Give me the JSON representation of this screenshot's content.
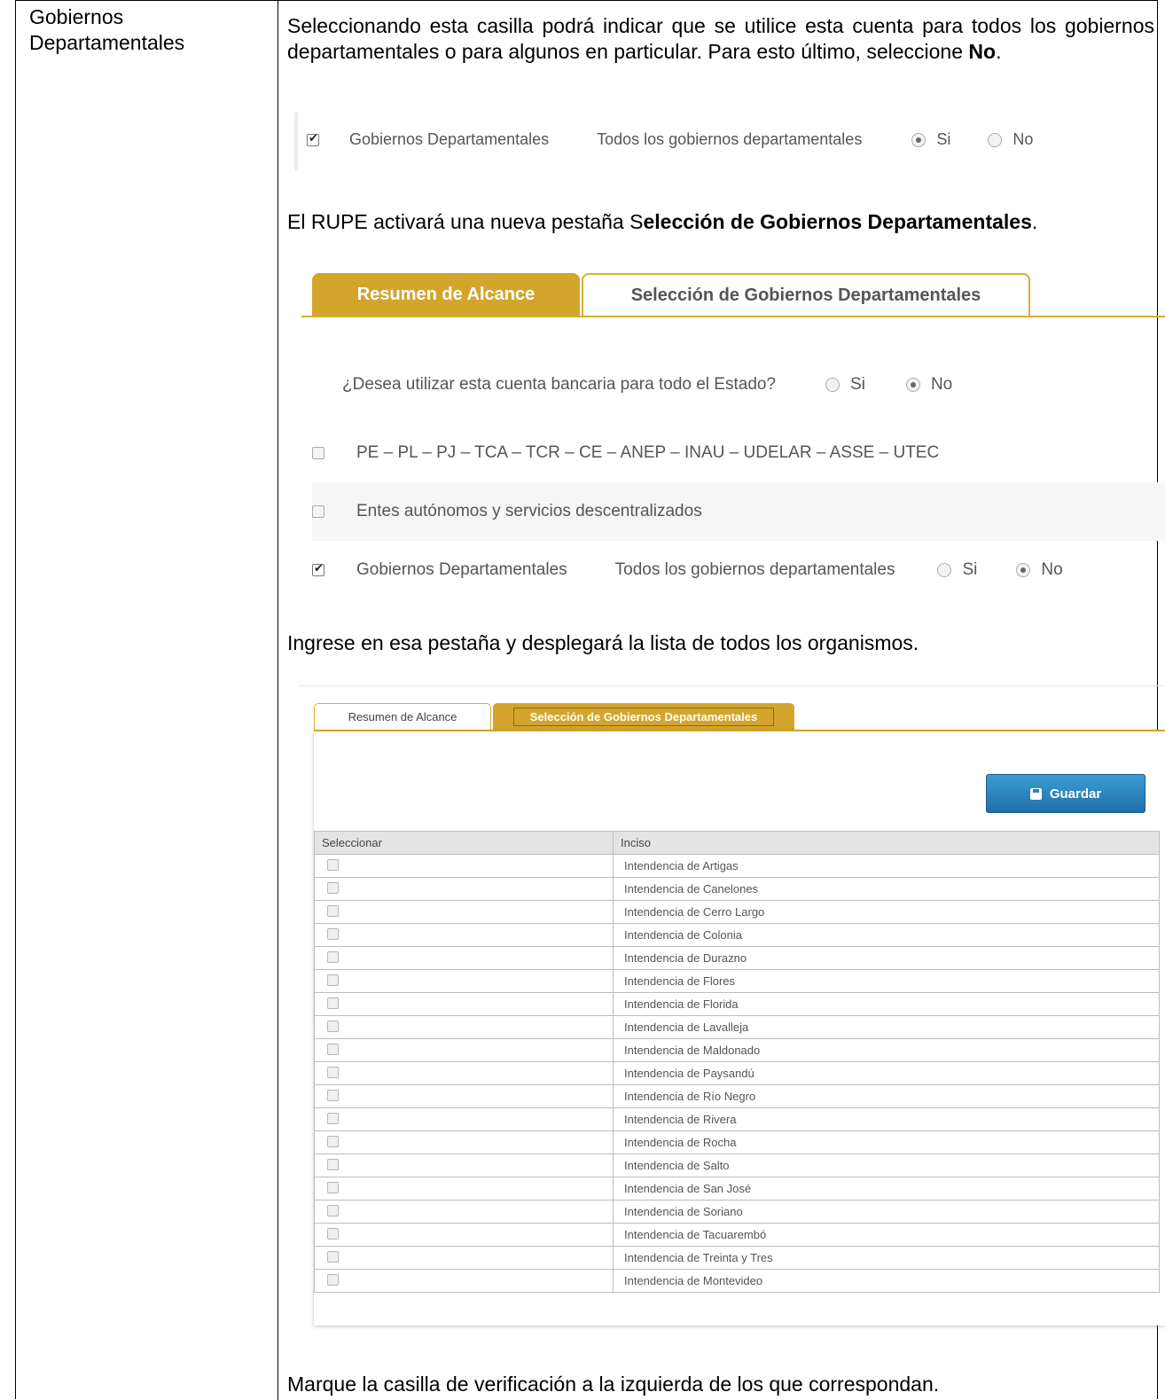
{
  "left_label": "Gobiernos Departamentales",
  "para1": {
    "text": "Seleccionando esta casilla podrá indicar que se utilice esta cuenta para todos los gobiernos departamentales o para algunos en particular. Para esto último, seleccione ",
    "bold": "No",
    "end": "."
  },
  "shot1": {
    "checkbox_label": "Gobiernos Departamentales",
    "question": "Todos los gobiernos departamentales",
    "opt_si": "Si",
    "opt_no": "No",
    "selected": "Si"
  },
  "para2": {
    "text": "El RUPE activará una nueva pestaña S",
    "bold": "elección de Gobiernos Departamentales",
    "end": "."
  },
  "shot2": {
    "tab_active": "Resumen de Alcance",
    "tab_inactive": "Selección de Gobiernos Departamentales",
    "question": "¿Desea utilizar esta cuenta bancaria para todo el Estado?",
    "opt_si": "Si",
    "opt_no": "No",
    "selected": "No",
    "line1": "PE – PL – PJ – TCA – TCR – CE – ANEP – INAU – UDELAR – ASSE – UTEC",
    "line2": "Entes autónomos y servicios descentralizados",
    "line3_label": "Gobiernos Departamentales",
    "line3_question": "Todos los gobiernos departamentales",
    "line3_selected": "No"
  },
  "para3": "Ingrese en esa pestaña y desplegará la lista de todos los organismos.",
  "shot3": {
    "tab_resumen": "Resumen de Alcance",
    "tab_seleccion": "Selección de Gobiernos Departamentales",
    "save_button": "Guardar",
    "col_select": "Seleccionar",
    "col_inciso": "Inciso",
    "rows": [
      "Intendencia de Artigas",
      "Intendencia de Canelones",
      "Intendencia de Cerro Largo",
      "Intendencia de Colonia",
      "Intendencia de Durazno",
      "Intendencia de Flores",
      "Intendencia de Florida",
      "Intendencia de Lavalleja",
      "Intendencia de Maldonado",
      "Intendencia de Paysandú",
      "Intendencia de Río Negro",
      "Intendencia de Rivera",
      "Intendencia de Rocha",
      "Intendencia de Salto",
      "Intendencia de San José",
      "Intendencia de Soriano",
      "Intendencia de Tacuarembó",
      "Intendencia de Treinta y Tres",
      "Intendencia de Montevideo"
    ]
  },
  "para4": "Marque la casilla de verificación a la izquierda de los que correspondan."
}
